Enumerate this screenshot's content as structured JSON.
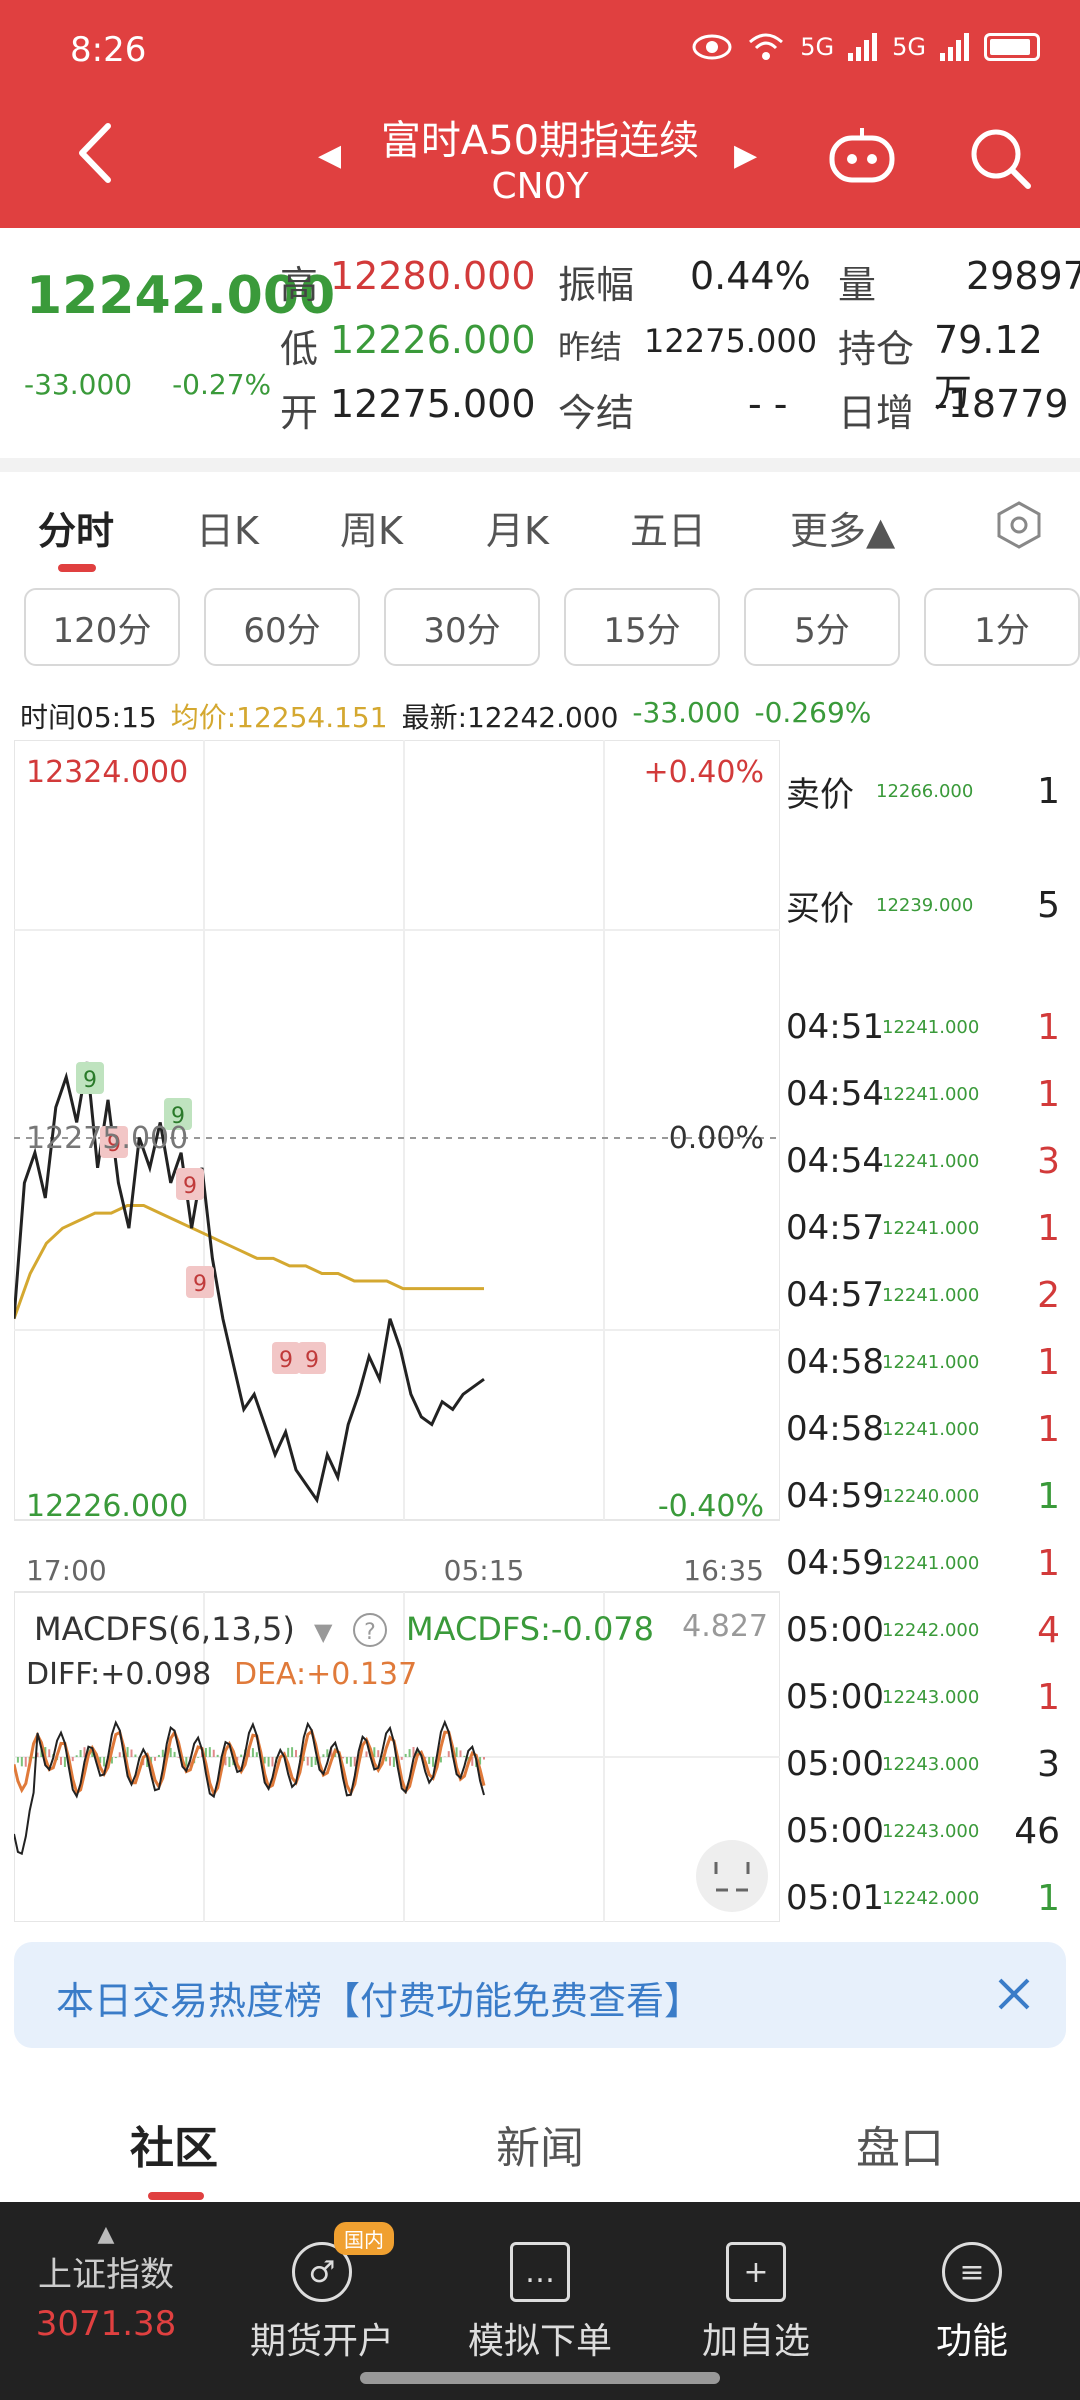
{
  "status": {
    "time": "8:26",
    "net1": "5G",
    "net2": "5G",
    "wifi": "6"
  },
  "header": {
    "title": "富时A50期指连续",
    "subtitle": "CN0Y"
  },
  "quote": {
    "last": "12242.000",
    "change": "-33.000",
    "change_pct": "-0.27%",
    "high_label": "高",
    "high": "12280.000",
    "low_label": "低",
    "low": "12226.000",
    "open_label": "开",
    "open": "12275.000",
    "amp_label": "振幅",
    "amp": "0.44%",
    "prev_label": "昨结",
    "prev": "12275.000",
    "settle_label": "今结",
    "settle": "- -",
    "vol_label": "量",
    "vol": "29897",
    "oi_label": "持仓",
    "oi": "79.12万",
    "daychg_label": "日增",
    "daychg": "-18779"
  },
  "tabs": [
    {
      "label": "分时"
    },
    {
      "label": "日K"
    },
    {
      "label": "周K"
    },
    {
      "label": "月K"
    },
    {
      "label": "五日"
    },
    {
      "label": "更多▲"
    }
  ],
  "periods": [
    "120分",
    "60分",
    "30分",
    "15分",
    "5分",
    "1分"
  ],
  "info": {
    "time": "时间05:15",
    "avg": "均价:12254.151",
    "latest": "最新:12242.000",
    "chg": "-33.000",
    "pct": "-0.269%"
  },
  "chart_data": {
    "type": "line",
    "price_top": "12324.000",
    "price_bottom": "12226.000",
    "price_mid": "12275.000",
    "pct_top": "+0.40%",
    "pct_mid": "0.00%",
    "pct_bottom": "-0.40%",
    "x_ticks": [
      "17:00",
      "05:15",
      "16:35"
    ],
    "ylim": [
      12226,
      12324
    ],
    "series": [
      {
        "values": [
          12250,
          12268,
          12272,
          12266,
          12278,
          12282,
          12276,
          12284,
          12270,
          12279,
          12268,
          12262,
          12274,
          12270,
          12276,
          12268,
          12272,
          12262,
          12270,
          12258,
          12250,
          12244,
          12238,
          12240,
          12236,
          12232,
          12235,
          12230,
          12228,
          12226,
          12232,
          12229,
          12236,
          12240,
          12245,
          12242,
          12250,
          12246,
          12240,
          12237,
          12236,
          12239,
          12238,
          12240,
          12241,
          12242
        ]
      },
      {
        "values": [
          12250,
          12256,
          12260,
          12262,
          12263,
          12264,
          12264,
          12265,
          12265,
          12264,
          12263,
          12262,
          12261,
          12260,
          12259,
          12258,
          12258,
          12257,
          12257,
          12256,
          12256,
          12255,
          12255,
          12255,
          12254,
          12254,
          12254,
          12254,
          12254,
          12254
        ]
      }
    ],
    "markers": [
      "9",
      "9",
      "9",
      "9",
      "9",
      "9",
      "9"
    ],
    "macd": {
      "label": "MACDFS(6,13,5)",
      "value_label": "MACDFS:-0.078",
      "top_value": "4.827",
      "diff": "DIFF:+0.098",
      "dea": "DEA:+0.137"
    }
  },
  "side": {
    "ask_label": "卖价",
    "ask_price": "12266.000",
    "ask_vol": "1",
    "bid_label": "买价",
    "bid_price": "12239.000",
    "bid_vol": "5",
    "trades": [
      {
        "time": "04:51",
        "price": "12241.000",
        "vol": "1",
        "dir": "red"
      },
      {
        "time": "04:54",
        "price": "12241.000",
        "vol": "1",
        "dir": "red"
      },
      {
        "time": "04:54",
        "price": "12241.000",
        "vol": "3",
        "dir": "red"
      },
      {
        "time": "04:57",
        "price": "12241.000",
        "vol": "1",
        "dir": "red"
      },
      {
        "time": "04:57",
        "price": "12241.000",
        "vol": "2",
        "dir": "red"
      },
      {
        "time": "04:58",
        "price": "12241.000",
        "vol": "1",
        "dir": "red"
      },
      {
        "time": "04:58",
        "price": "12241.000",
        "vol": "1",
        "dir": "red"
      },
      {
        "time": "04:59",
        "price": "12240.000",
        "vol": "1",
        "dir": "green"
      },
      {
        "time": "04:59",
        "price": "12241.000",
        "vol": "1",
        "dir": "red"
      },
      {
        "time": "05:00",
        "price": "12242.000",
        "vol": "4",
        "dir": "red"
      },
      {
        "time": "05:00",
        "price": "12243.000",
        "vol": "1",
        "dir": "red"
      },
      {
        "time": "05:00",
        "price": "12243.000",
        "vol": "3",
        "dir": "dark"
      },
      {
        "time": "05:00",
        "price": "12243.000",
        "vol": "46",
        "dir": "dark"
      },
      {
        "time": "05:01",
        "price": "12242.000",
        "vol": "1",
        "dir": "green"
      }
    ]
  },
  "banner": {
    "text": "本日交易热度榜【付费功能免费查看】"
  },
  "bottom_tabs": [
    "社区",
    "新闻",
    "盘口"
  ],
  "nav": {
    "index_name": "上证指数",
    "index_value": "3071.38",
    "items": [
      "期货开户",
      "模拟下单",
      "加自选",
      "功能"
    ],
    "badge": "国内"
  },
  "colors": {
    "header": "#e04040",
    "up": "#d23a3a",
    "down": "#3a9a3a",
    "avg": "#d4a830"
  }
}
